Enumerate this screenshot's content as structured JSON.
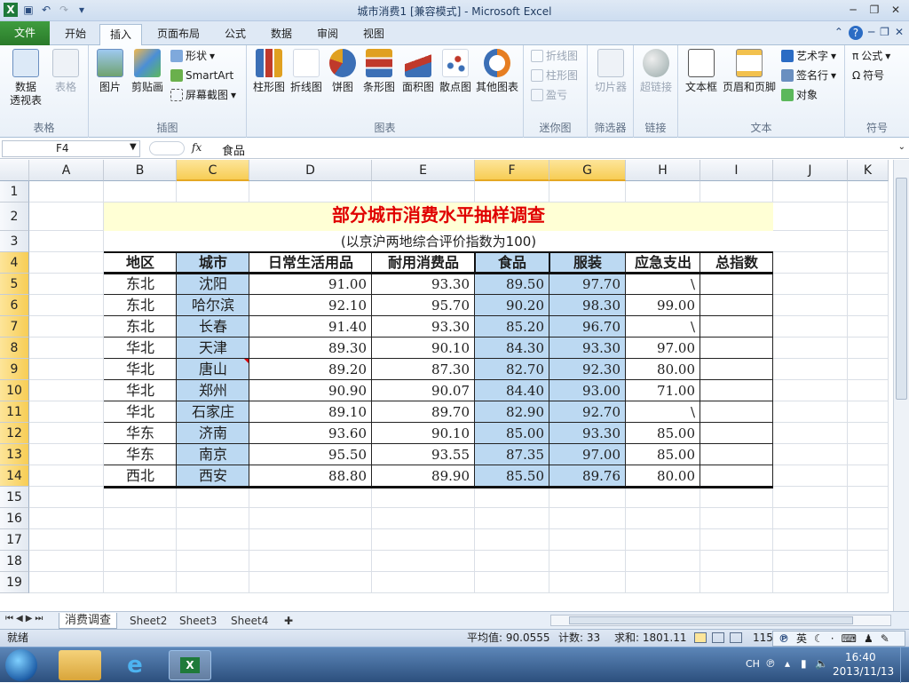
{
  "window": {
    "title": "城市消费1  [兼容模式] - Microsoft Excel"
  },
  "tabs": [
    "文件",
    "开始",
    "插入",
    "页面布局",
    "公式",
    "数据",
    "审阅",
    "视图"
  ],
  "active_tab": "插入",
  "ribbon": {
    "groups": [
      "表格",
      "插图",
      "图表",
      "迷你图",
      "筛选器",
      "链接",
      "文本",
      "符号"
    ],
    "pivot": "数据\n透视表",
    "table": "表格",
    "picture": "图片",
    "clipart": "剪贴画",
    "shapes": "形状",
    "smartart": "SmartArt",
    "screenshot": "屏幕截图",
    "charts": [
      "柱形图",
      "折线图",
      "饼图",
      "条形图",
      "面积图",
      "散点图",
      "其他图表"
    ],
    "spark": [
      "折线图",
      "柱形图",
      "盈亏"
    ],
    "slicer": "切片器",
    "hyperlink": "超链接",
    "textbox": "文本框",
    "header_footer": "页眉和页脚",
    "wordart": "艺术字",
    "signature": "签名行",
    "object": "对象",
    "equation": "公式",
    "symbol": "符号"
  },
  "formula_bar": {
    "name_box": "F4",
    "fx": "fx",
    "content": "食品"
  },
  "columns": [
    "A",
    "B",
    "C",
    "D",
    "E",
    "F",
    "G",
    "H",
    "I",
    "J",
    "K"
  ],
  "rows": [
    "1",
    "2",
    "3",
    "4",
    "5",
    "6",
    "7",
    "8",
    "9",
    "10",
    "11",
    "12",
    "13",
    "14",
    "15",
    "16",
    "17",
    "18",
    "19"
  ],
  "sheet": {
    "title": "部分城市消费水平抽样调查",
    "subtitle": "(以京沪两地综合评价指数为100)",
    "headers": [
      "地区",
      "城市",
      "日常生活用品",
      "耐用消费品",
      "食品",
      "服装",
      "应急支出",
      "总指数"
    ],
    "data": [
      [
        "东北",
        "沈阳",
        "91.00",
        "93.30",
        "89.50",
        "97.70",
        "\\",
        ""
      ],
      [
        "东北",
        "哈尔滨",
        "92.10",
        "95.70",
        "90.20",
        "98.30",
        "99.00",
        ""
      ],
      [
        "东北",
        "长春",
        "91.40",
        "93.30",
        "85.20",
        "96.70",
        "\\",
        ""
      ],
      [
        "华北",
        "天津",
        "89.30",
        "90.10",
        "84.30",
        "93.30",
        "97.00",
        ""
      ],
      [
        "华北",
        "唐山",
        "89.20",
        "87.30",
        "82.70",
        "92.30",
        "80.00",
        ""
      ],
      [
        "华北",
        "郑州",
        "90.90",
        "90.07",
        "84.40",
        "93.00",
        "71.00",
        ""
      ],
      [
        "华北",
        "石家庄",
        "89.10",
        "89.70",
        "82.90",
        "92.70",
        "\\",
        ""
      ],
      [
        "华东",
        "济南",
        "93.60",
        "90.10",
        "85.00",
        "93.30",
        "85.00",
        ""
      ],
      [
        "华东",
        "南京",
        "95.50",
        "93.55",
        "87.35",
        "97.00",
        "85.00",
        ""
      ],
      [
        "西北",
        "西安",
        "88.80",
        "89.90",
        "85.50",
        "89.76",
        "80.00",
        ""
      ]
    ]
  },
  "sheet_tabs": [
    "消费调查",
    "Sheet2",
    "Sheet3",
    "Sheet4"
  ],
  "status": {
    "ready": "就绪",
    "average": "平均值: 90.0555",
    "count": "计数: 33",
    "sum": "求和: 1801.11",
    "zoom": "115"
  },
  "ime": {
    "lang": "英"
  },
  "taskbar": {
    "lang": "CH",
    "time": "16:40",
    "date": "2013/11/13"
  },
  "colors": {
    "title_red": "#e00000",
    "title_band": "#ffffd5",
    "blue_fill": "#bcd9f2",
    "selected_header": "#f7cd55"
  }
}
